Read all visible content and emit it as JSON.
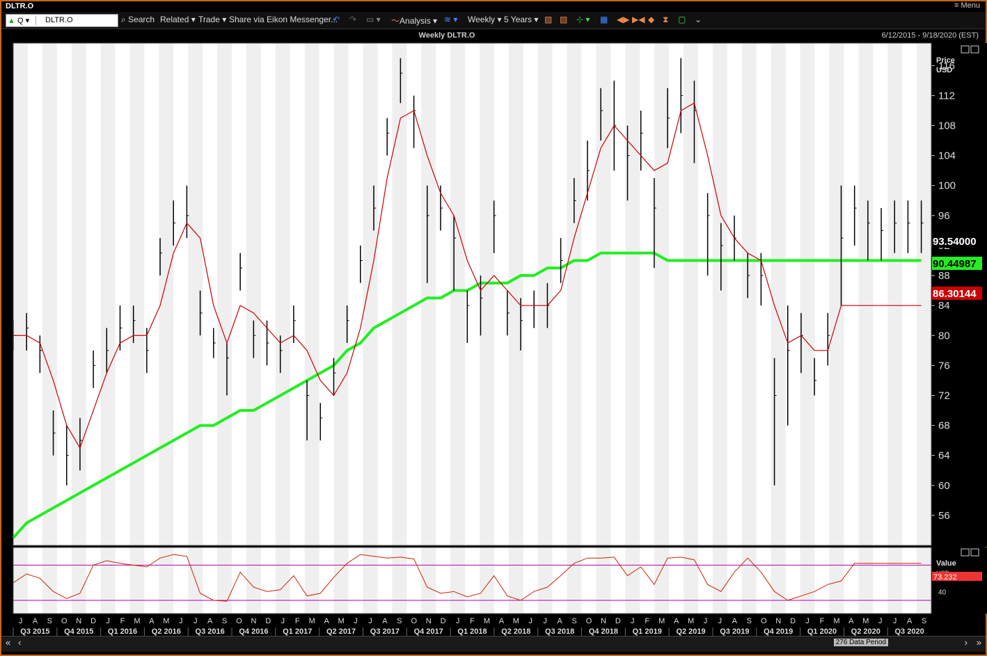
{
  "window": {
    "title": "DLTR.O",
    "menu_label": "Menu"
  },
  "toolbar": {
    "ric_value": "DLTR.O",
    "q_label": "Q",
    "search_label": "Search",
    "related_label": "Related",
    "trade_label": "Trade",
    "share_label": "Share via Eikon Messenger...",
    "analysis_label": "Analysis",
    "interval_label": "Weekly",
    "range_label": "5 Years"
  },
  "header": {
    "chart_title": "Weekly DLTR.O",
    "date_range": "6/12/2015 - 9/18/2020 (EST)"
  },
  "footer": {
    "data_period": "276 Data Period"
  },
  "colors": {
    "background": "#000000",
    "plot_bg": "#ffffff",
    "band": "#efefef",
    "ma_long": "#22ee22",
    "ma_short": "#cc0000",
    "rsi_line": "#cc2200",
    "rsi_bounds": "#aa00aa"
  },
  "chart_data": [
    {
      "type": "line",
      "name": "price",
      "price_unit_label": [
        "Price",
        "USD"
      ],
      "ylim": [
        52,
        119
      ],
      "yticks": [
        56,
        60,
        64,
        68,
        72,
        76,
        80,
        84,
        88,
        92,
        96,
        100,
        104,
        108,
        112,
        116
      ],
      "x_start": "2015-06-12",
      "x_end": "2020-09-18",
      "x_unit": "weeks",
      "month_labels": [
        "J",
        "A",
        "S",
        "O",
        "N",
        "D",
        "J",
        "F",
        "M",
        "A",
        "M",
        "J",
        "J",
        "A",
        "S",
        "O",
        "N",
        "D",
        "J",
        "F",
        "M",
        "A",
        "M",
        "J",
        "J",
        "A",
        "S",
        "O",
        "N",
        "D",
        "J",
        "F",
        "M",
        "A",
        "M",
        "J",
        "J",
        "A",
        "S",
        "O",
        "N",
        "D",
        "J",
        "F",
        "M",
        "A",
        "M",
        "J",
        "J",
        "A",
        "S",
        "O",
        "N",
        "D",
        "J",
        "F",
        "M",
        "A",
        "M",
        "J",
        "J",
        "A",
        "S"
      ],
      "quarter_labels": [
        "Q3 2015",
        "Q4 2015",
        "Q1 2016",
        "Q2 2016",
        "Q3 2016",
        "Q4 2016",
        "Q1 2017",
        "Q2 2017",
        "Q3 2017",
        "Q4 2017",
        "Q1 2018",
        "Q2 2018",
        "Q3 2018",
        "Q4 2018",
        "Q1 2019",
        "Q2 2019",
        "Q3 2019",
        "Q4 2019",
        "Q1 2020",
        "Q2 2020",
        "Q3 2020"
      ],
      "series": [
        {
          "name": "close",
          "x_weeks": [
            0,
            4,
            8,
            12,
            16,
            20,
            24,
            28,
            32,
            36,
            40,
            44,
            48,
            52,
            56,
            60,
            64,
            68,
            72,
            76,
            80,
            84,
            88,
            92,
            96,
            100,
            104,
            108,
            112,
            116,
            120,
            124,
            128,
            132,
            136,
            140,
            144,
            148,
            152,
            156,
            160,
            164,
            168,
            172,
            176,
            180,
            184,
            188,
            192,
            196,
            200,
            204,
            208,
            212,
            216,
            220,
            224,
            228,
            232,
            236,
            240,
            244,
            248,
            252,
            256,
            260,
            264,
            268,
            272
          ],
          "values": [
            80,
            81,
            78,
            67,
            64,
            66,
            76,
            78,
            81,
            82,
            78,
            91,
            95,
            96,
            83,
            79,
            77,
            89,
            80,
            79,
            78,
            82,
            72,
            69,
            75,
            82,
            90,
            97,
            107,
            115,
            110,
            96,
            97,
            93,
            84,
            85,
            96,
            83,
            82,
            84,
            84,
            90,
            98,
            102,
            110,
            108,
            104,
            107,
            97,
            109,
            112,
            110,
            96,
            92,
            93,
            88,
            88,
            72,
            78,
            80,
            74,
            80,
            93,
            97,
            95,
            94,
            95,
            95,
            95
          ]
        },
        {
          "name": "high",
          "values": [
            82,
            83,
            80,
            70,
            68,
            69,
            78,
            81,
            84,
            84,
            81,
            93,
            98,
            100,
            86,
            81,
            79,
            91,
            82,
            82,
            80,
            84,
            74,
            71,
            77,
            84,
            92,
            100,
            109,
            117,
            112,
            100,
            100,
            96,
            86,
            88,
            98,
            86,
            85,
            86,
            87,
            93,
            101,
            106,
            113,
            114,
            108,
            110,
            101,
            113,
            117,
            114,
            99,
            95,
            96,
            91,
            91,
            77,
            84,
            83,
            77,
            83,
            100,
            100,
            98,
            97,
            98,
            98,
            98
          ]
        },
        {
          "name": "low",
          "values": [
            78,
            78,
            75,
            64,
            60,
            62,
            73,
            75,
            78,
            79,
            75,
            88,
            92,
            93,
            80,
            77,
            72,
            86,
            77,
            76,
            75,
            79,
            66,
            66,
            72,
            79,
            87,
            94,
            104,
            111,
            105,
            87,
            94,
            86,
            79,
            80,
            91,
            80,
            78,
            81,
            81,
            87,
            95,
            98,
            106,
            102,
            98,
            102,
            89,
            105,
            107,
            103,
            88,
            86,
            90,
            85,
            84,
            60,
            68,
            75,
            72,
            76,
            84,
            92,
            90,
            90,
            91,
            91,
            91
          ]
        },
        {
          "name": "ma_short",
          "values": [
            80,
            80,
            79,
            74,
            68,
            65,
            70,
            75,
            79,
            80,
            80,
            84,
            91,
            95,
            93,
            84,
            79,
            84,
            83,
            81,
            79,
            80,
            78,
            74,
            72,
            75,
            81,
            90,
            101,
            109,
            110,
            104,
            99,
            96,
            90,
            86,
            88,
            86,
            84,
            84,
            84,
            86,
            93,
            99,
            105,
            108,
            106,
            104,
            102,
            103,
            110,
            111,
            104,
            96,
            93,
            91,
            90,
            84,
            79,
            80,
            78,
            78,
            84,
            84,
            84,
            84,
            84,
            84,
            84
          ]
        },
        {
          "name": "ma_long",
          "values": [
            53,
            55,
            56,
            57,
            58,
            59,
            60,
            61,
            62,
            63,
            64,
            65,
            66,
            67,
            68,
            68,
            69,
            70,
            70,
            71,
            72,
            73,
            74,
            75,
            76,
            78,
            79,
            81,
            82,
            83,
            84,
            85,
            85,
            86,
            86,
            87,
            87,
            87,
            88,
            88,
            89,
            89,
            90,
            90,
            91,
            91,
            91,
            91,
            91,
            90,
            90,
            90,
            90,
            90,
            90,
            90,
            90,
            90,
            90,
            90,
            90,
            90,
            90,
            90,
            90,
            90,
            90,
            90,
            90
          ]
        }
      ],
      "current_labels": [
        {
          "value": "93.54000",
          "color": "#000000"
        },
        {
          "value": "90.44987",
          "color": "#22ee22"
        },
        {
          "value": "86.30144",
          "color": "#cc0000"
        }
      ],
      "auto_label": "Auto"
    },
    {
      "type": "line",
      "name": "rsi",
      "value_label": "Value",
      "unit_label": "USD",
      "ylim": [
        15,
        90
      ],
      "yticks": [
        40
      ],
      "bounds": [
        70,
        30
      ],
      "current_label": "73.232",
      "auto_label": "Auto",
      "series": [
        {
          "name": "value",
          "values": [
            50,
            60,
            55,
            40,
            32,
            38,
            70,
            75,
            72,
            70,
            68,
            78,
            82,
            80,
            38,
            30,
            29,
            62,
            45,
            40,
            42,
            58,
            35,
            38,
            56,
            72,
            82,
            80,
            78,
            79,
            77,
            45,
            38,
            40,
            34,
            38,
            58,
            35,
            30,
            40,
            45,
            58,
            72,
            78,
            78,
            79,
            58,
            68,
            48,
            78,
            79,
            76,
            48,
            40,
            62,
            78,
            62,
            40,
            30,
            35,
            40,
            48,
            52,
            72,
            72,
            72,
            72,
            72,
            72
          ]
        }
      ]
    }
  ]
}
